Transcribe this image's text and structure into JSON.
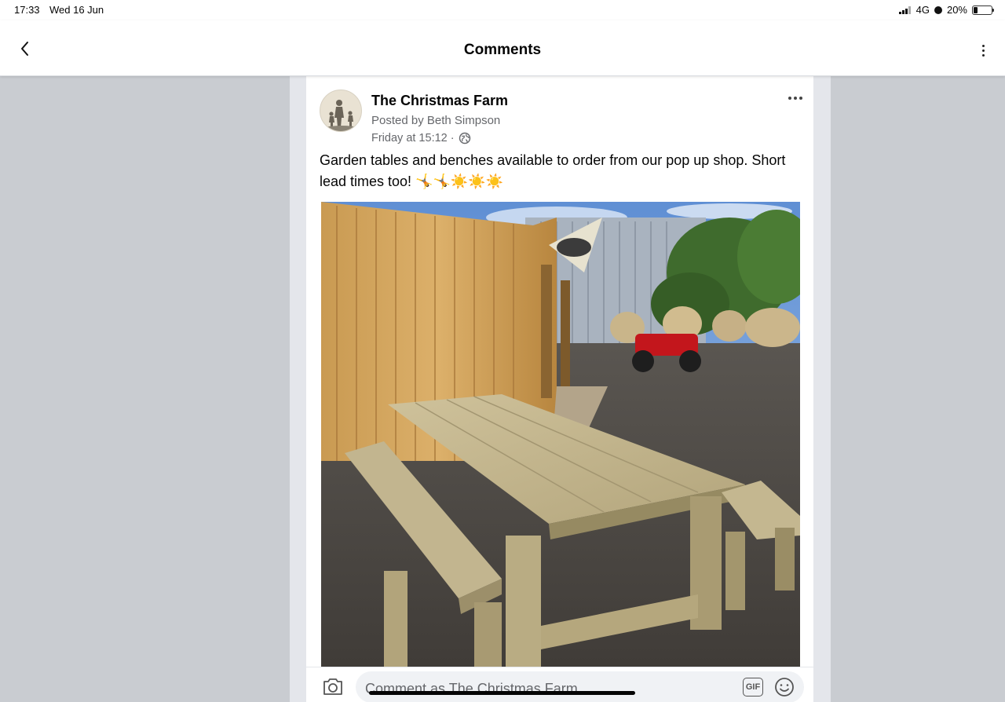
{
  "status_bar": {
    "time": "17:33",
    "date": "Wed 16 Jun",
    "network": "4G",
    "battery": "20%"
  },
  "header": {
    "title": "Comments"
  },
  "post": {
    "page_name": "The Christmas Farm",
    "posted_by": "Posted by Beth Simpson",
    "time": "Friday at 15:12 ·",
    "text": "Garden tables and benches available to order from our pop up shop. Short lead times too! 🤸🤸☀️☀️☀️"
  },
  "composer": {
    "placeholder": "Comment as The Christmas Farm",
    "gif_label": "GIF"
  }
}
